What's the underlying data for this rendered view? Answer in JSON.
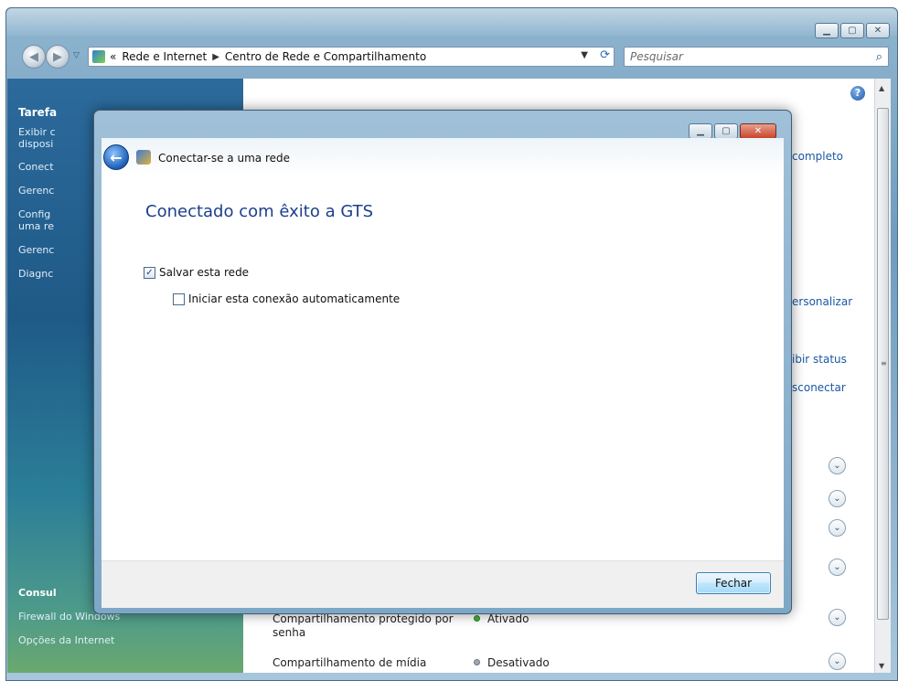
{
  "explorer": {
    "address": {
      "chevrons": "«",
      "crumb1": "Rede e Internet",
      "crumb2": "Centro de Rede e Compartilhamento"
    },
    "search_placeholder": "Pesquisar",
    "tasks_title": "Tarefa",
    "tasks": [
      "Exibir c",
      "disposi",
      "Conect",
      "Gerenc",
      "Config",
      "uma re",
      "Gerenc",
      "Diagnc"
    ],
    "see_also_title": "Consul",
    "see_also_links": [
      "Firewall do Windows",
      "Opções da Internet"
    ],
    "peek_texts": [
      "completo",
      "ersonalizar",
      "ibir status",
      "sconectar"
    ],
    "sharing": [
      {
        "label": "Compartilhamento protegido por senha",
        "status": "Ativado",
        "on": true
      },
      {
        "label": "Compartilhamento de mídia",
        "status": "Desativado",
        "on": false
      }
    ]
  },
  "dialog": {
    "title": "Conectar-se a uma rede",
    "heading": "Conectado com êxito a GTS",
    "save_network_label": "Salvar esta rede",
    "save_network_checked": true,
    "auto_connect_label": "Iniciar esta conexão automaticamente",
    "auto_connect_checked": false,
    "close_button": "Fechar"
  }
}
